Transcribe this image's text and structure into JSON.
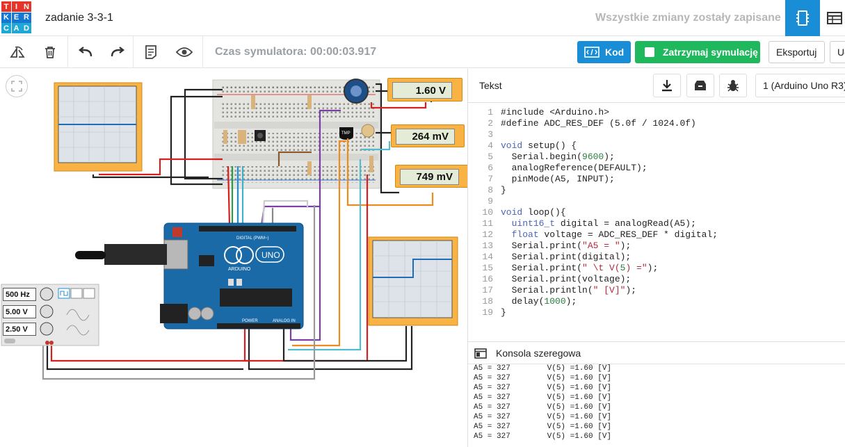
{
  "app": {
    "logo_letters": [
      "T",
      "I",
      "N",
      "K",
      "E",
      "R",
      "C",
      "A",
      "D"
    ],
    "logo_colors": [
      "#e5352b",
      "#e5352b",
      "#e5352b",
      "#1477d4",
      "#1477d4",
      "#1477d4",
      "#1fa7d6",
      "#1fa7d6",
      "#1fa7d6"
    ],
    "project_title": "zadanie 3-3-1",
    "save_status": "Wszystkie zmiany zostały zapisane"
  },
  "toolbar": {
    "sim_time": "Czas symulatora: 00:00:03.917",
    "code_label": "Kod",
    "stop_label": "Zatrzymaj symulację",
    "export_label": "Eksportuj",
    "share_label": "Ud",
    "code_color": "#1a8dd7",
    "stop_color": "#1fb85c"
  },
  "code": {
    "mode": "Tekst",
    "device": "1 (Arduino Uno R3)",
    "lines": [
      "#include <Arduino.h>",
      "#define ADC_RES_DEF (5.0f / 1024.0f)",
      "",
      "void setup() {",
      "  Serial.begin(9600);",
      "  analogReference(DEFAULT);",
      "  pinMode(A5, INPUT);",
      "}",
      "",
      "void loop(){",
      "  uint16_t digital = analogRead(A5);",
      "  float voltage = ADC_RES_DEF * digital;",
      "  Serial.print(\"A5 = \");",
      "  Serial.print(digital);",
      "  Serial.print(\" \\t V(5) =\");",
      "  Serial.print(voltage);",
      "  Serial.println(\" [V]\");",
      "  delay(1000);",
      "}"
    ]
  },
  "console": {
    "title": "Konsola szeregowa",
    "lines": [
      "A5 = 327        V(5) =1.60 [V]",
      "A5 = 327        V(5) =1.60 [V]",
      "A5 = 327        V(5) =1.60 [V]",
      "A5 = 327        V(5) =1.60 [V]",
      "A5 = 327        V(5) =1.60 [V]",
      "A5 = 327        V(5) =1.60 [V]",
      "A5 = 327        V(5) =1.60 [V]",
      "A5 = 327        V(5) =1.60 [V]"
    ]
  },
  "circuit": {
    "meter1": "1.60 V",
    "meter2": "264 mV",
    "meter3": "749 mV",
    "fg_freq": "500 Hz",
    "fg_amp": "5.00 V",
    "fg_offset": "2.50 V",
    "board_uno": "UNO",
    "board_brand": "ARDUINO",
    "board_digital": "DIGITAL (PWM~)",
    "board_power": "POWER",
    "board_analog": "ANALOG IN",
    "sensor_label": "TMP"
  }
}
